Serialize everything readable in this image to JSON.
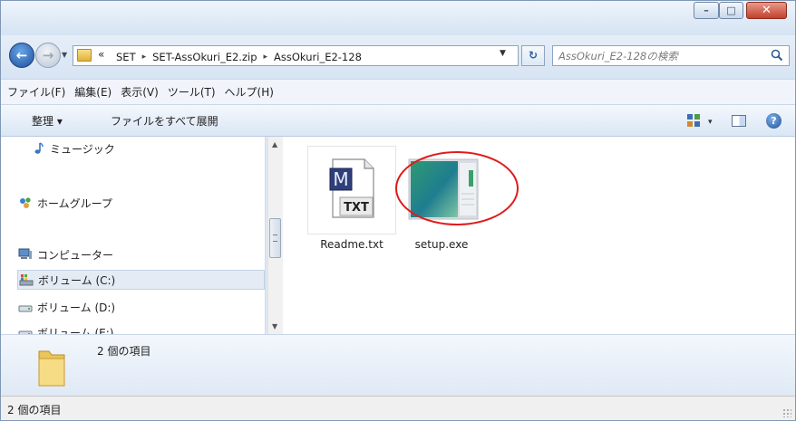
{
  "window": {
    "minimize_glyph": "–",
    "maximize_glyph": "□",
    "close_glyph": "✕"
  },
  "address": {
    "overflow_chevron": "«",
    "breadcrumbs": [
      "SET",
      "SET-AssOkuri_E2.zip",
      "AssOkuri_E2-128"
    ],
    "separator": "▸",
    "dropdown_glyph": "▼",
    "refresh_glyph": "↻"
  },
  "search": {
    "placeholder": "AssOkuri_E2-128の検索"
  },
  "menu": {
    "items": [
      "ファイル(F)",
      "編集(E)",
      "表示(V)",
      "ツール(T)",
      "ヘルプ(H)"
    ]
  },
  "toolbar": {
    "organize_label": "整理 ▾",
    "extract_label": "ファイルをすべて展開",
    "view_dropdown_glyph": "▾",
    "help_glyph": "?"
  },
  "navigation": {
    "items": [
      {
        "label": "ミュージック",
        "icon": "music-icon"
      },
      {
        "label": "ホームグループ",
        "icon": "homegroup-icon"
      },
      {
        "label": "コンピューター",
        "icon": "computer-icon"
      },
      {
        "label": "ボリューム (C:)",
        "icon": "system-drive-icon",
        "selected": true
      },
      {
        "label": "ボリューム (D:)",
        "icon": "drive-icon"
      },
      {
        "label": "ボリューム (E:)",
        "icon": "drive-icon"
      }
    ],
    "scroll_up_glyph": "▲",
    "scroll_down_glyph": "▼"
  },
  "files": [
    {
      "name": "Readme.txt",
      "icon": "text-file-icon",
      "badge": "TXT",
      "glyph": "M"
    },
    {
      "name": "setup.exe",
      "icon": "setup-exe-icon"
    }
  ],
  "details": {
    "count": "2 個の項目"
  },
  "status": {
    "text": "2 個の項目"
  },
  "colors": {
    "highlight_circle": "#e01b1b",
    "accent": "#1d4f9a"
  }
}
